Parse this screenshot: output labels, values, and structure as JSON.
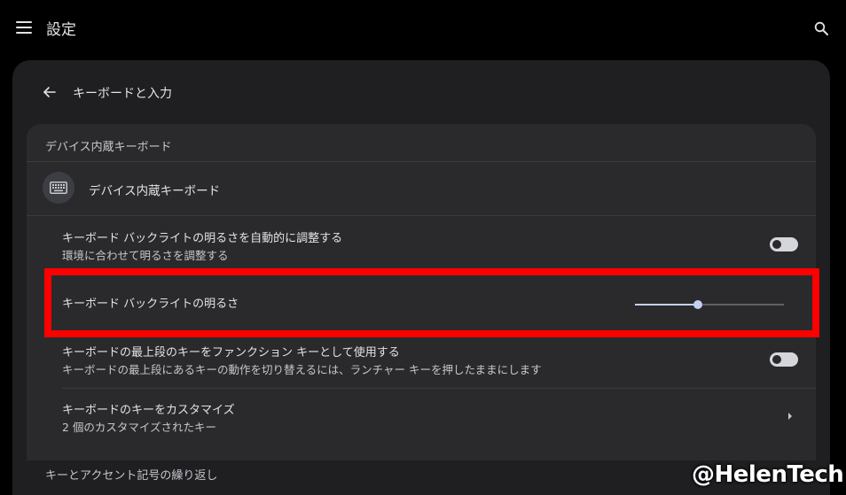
{
  "topbar": {
    "title": "設定"
  },
  "header": {
    "back_title": "キーボードと入力"
  },
  "section1": {
    "heading": "デバイス内蔵キーボード",
    "device_label": "デバイス内蔵キーボード"
  },
  "rows": {
    "auto_backlight": {
      "title": "キーボード バックライトの明るさを自動的に調整する",
      "subtitle": "環境に合わせて明るさを調整する",
      "toggle_on": false
    },
    "backlight": {
      "title": "キーボード バックライトの明るさ",
      "value_fraction": 0.42
    },
    "function_keys": {
      "title": "キーボードの最上段のキーをファンクション キーとして使用する",
      "subtitle": "キーボードの最上段にあるキーの動作を切り替えるには、ランチャー キーを押したままにします",
      "toggle_on": false
    },
    "customize": {
      "title": "キーボードのキーをカスタマイズ",
      "subtitle": "2 個のカスタマイズされたキー"
    }
  },
  "section2": {
    "heading": "キーとアクセント記号の繰り返し"
  },
  "watermark": "@HelenTech",
  "colors": {
    "page_bg": "#000000",
    "panel_bg": "#1f1f22",
    "card_bg": "#2a2a2d",
    "accent": "#c2d2f0",
    "highlight": "#ff0000"
  },
  "icons": [
    "menu-icon",
    "search-icon",
    "back-arrow-icon",
    "keyboard-icon",
    "chevron-right-icon"
  ]
}
